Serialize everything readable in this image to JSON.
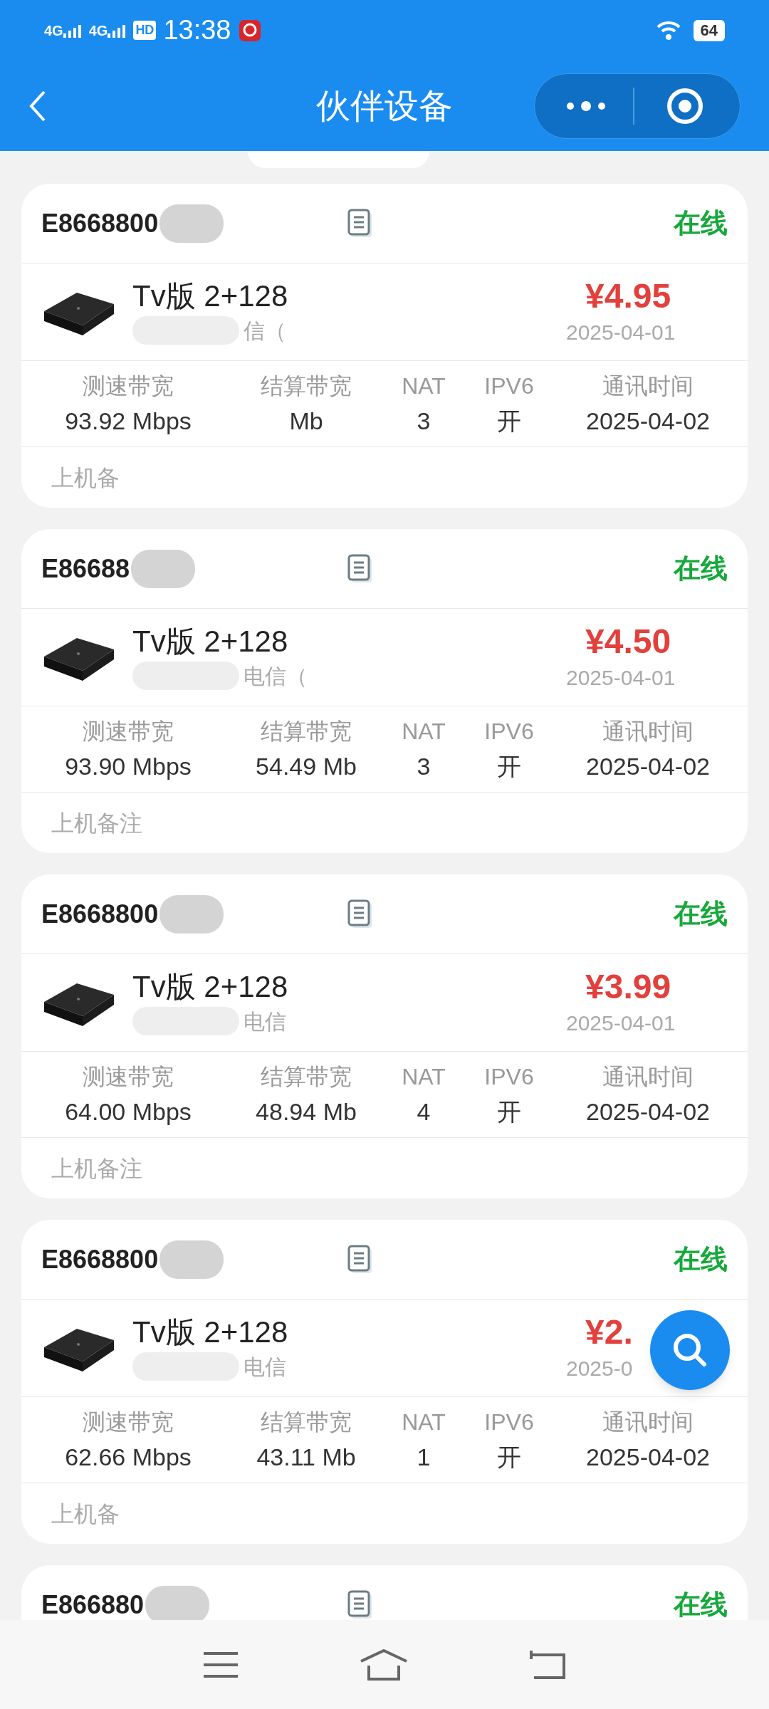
{
  "status_bar": {
    "network_1": "4G",
    "network_2": "4G",
    "hd": "HD",
    "time": "13:38",
    "battery": "64"
  },
  "header": {
    "title": "伙伴设备"
  },
  "devices": [
    {
      "id": "E8668800",
      "status": "在线",
      "online": true,
      "name": "Tv版 2+128",
      "carrier": "信（",
      "price": "¥4.95",
      "date": "2025-04-01",
      "stats": [
        {
          "label": "测速带宽",
          "value": "93.92 Mbps"
        },
        {
          "label": "结算带宽",
          "value": "Mb"
        },
        {
          "label": "NAT",
          "value": "3"
        },
        {
          "label": "IPV6",
          "value": "开"
        },
        {
          "label": "通讯时间",
          "value": "2025-04-02"
        }
      ],
      "note": "上机备"
    },
    {
      "id": "E86688",
      "status": "在线",
      "online": true,
      "name": "Tv版 2+128",
      "carrier": "电信（",
      "price": "¥4.50",
      "date": "2025-04-01",
      "stats": [
        {
          "label": "测速带宽",
          "value": "93.90 Mbps"
        },
        {
          "label": "结算带宽",
          "value": "54.49 Mb"
        },
        {
          "label": "NAT",
          "value": "3"
        },
        {
          "label": "IPV6",
          "value": "开"
        },
        {
          "label": "通讯时间",
          "value": "2025-04-02"
        }
      ],
      "note": "上机备注"
    },
    {
      "id": "E8668800",
      "status": "在线",
      "online": true,
      "name": "Tv版 2+128",
      "carrier": "电信",
      "price": "¥3.99",
      "date": "2025-04-01",
      "stats": [
        {
          "label": "测速带宽",
          "value": "64.00 Mbps"
        },
        {
          "label": "结算带宽",
          "value": "48.94 Mb"
        },
        {
          "label": "NAT",
          "value": "4"
        },
        {
          "label": "IPV6",
          "value": "开"
        },
        {
          "label": "通讯时间",
          "value": "2025-04-02"
        }
      ],
      "note": "上机备注"
    },
    {
      "id": "E8668800",
      "status": "在线",
      "online": true,
      "name": "Tv版 2+128",
      "carrier": "电信",
      "price": "¥2.",
      "date": "2025-0",
      "stats": [
        {
          "label": "测速带宽",
          "value": "62.66 Mbps"
        },
        {
          "label": "结算带宽",
          "value": "43.11 Mb"
        },
        {
          "label": "NAT",
          "value": "1"
        },
        {
          "label": "IPV6",
          "value": "开"
        },
        {
          "label": "通讯时间",
          "value": "2025-04-02"
        }
      ],
      "note": "上机备"
    },
    {
      "id": "E866880",
      "status": "在线",
      "online": true
    }
  ]
}
